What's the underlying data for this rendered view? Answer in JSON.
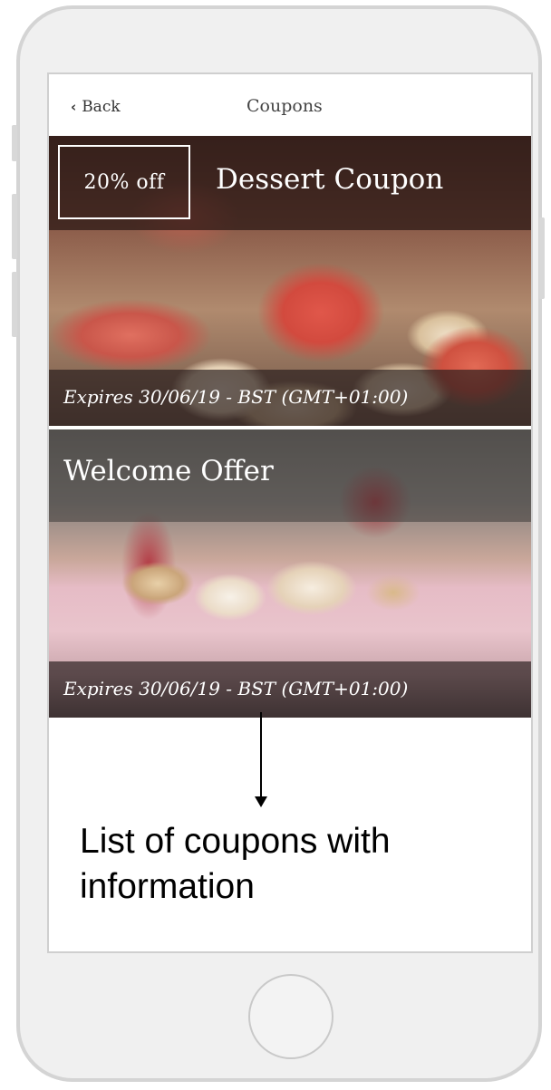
{
  "navbar": {
    "back_label": "Back",
    "title": "Coupons",
    "back_icon": "chevron-left-icon"
  },
  "coupons": [
    {
      "discount": "20% off",
      "title": "Dessert Coupon",
      "expiry": "Expires 30/06/19 - BST (GMT+01:00)"
    },
    {
      "title": "Welcome Offer",
      "expiry": "Expires 30/06/19 - BST (GMT+01:00)"
    }
  ],
  "annotation": {
    "text": "List of coupons with information"
  }
}
